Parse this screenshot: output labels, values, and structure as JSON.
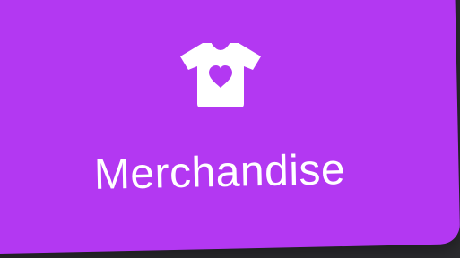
{
  "tile": {
    "label": "Merchandise",
    "icon": "tshirt-heart-icon",
    "background_color": "#b338f2",
    "text_color": "#ffffff"
  }
}
